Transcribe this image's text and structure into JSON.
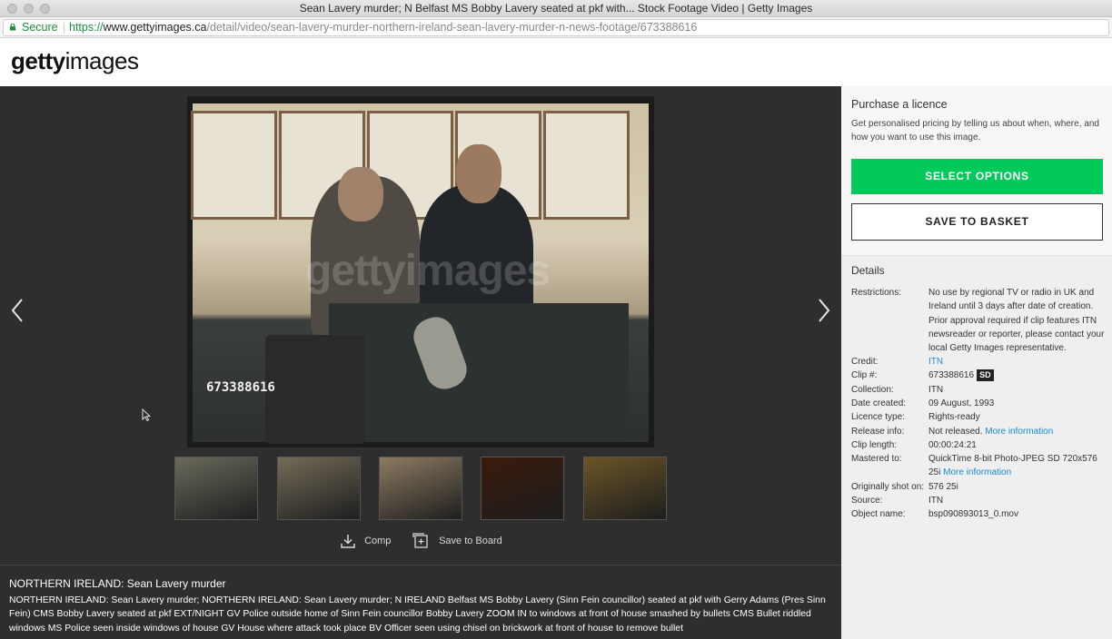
{
  "window": {
    "title": "Sean Lavery murder; N Belfast MS Bobby Lavery seated at pkf with... Stock Footage Video | Getty Images"
  },
  "address_bar": {
    "secure_label": "Secure",
    "url_scheme": "https://",
    "url_host": "www.gettyimages.ca",
    "url_path": "/detail/video/sean-lavery-murder-northern-ireland-sean-lavery-murder-n-news-footage/673388616"
  },
  "header": {
    "logo_bold": "getty",
    "logo_light": "images"
  },
  "player": {
    "watermark": "gettyimages",
    "clip_number_overlay": "673388616",
    "prev_icon": "chevron-left-icon",
    "next_icon": "chevron-right-icon"
  },
  "thumbnails": [
    {
      "label": "thumbnail-1",
      "color": "#6b6a5c"
    },
    {
      "label": "thumbnail-2",
      "color": "#746b58"
    },
    {
      "label": "thumbnail-3",
      "color": "#8c7b62"
    },
    {
      "label": "thumbnail-4",
      "color": "#3a1a0c"
    },
    {
      "label": "thumbnail-5",
      "color": "#6a5526"
    }
  ],
  "actions": {
    "comp_label": "Comp",
    "save_board_label": "Save to Board"
  },
  "caption": {
    "title": "NORTHERN IRELAND: Sean Lavery murder",
    "body": "NORTHERN IRELAND: Sean Lavery murder; NORTHERN IRELAND: Sean Lavery murder; N IRELAND Belfast MS Bobby Lavery (Sinn Fein councillor) seated at pkf with Gerry Adams (Pres Sinn Fein) CMS Bobby Lavery seated at pkf EXT/NIGHT GV Police outside home of Sinn Fein councillor Bobby Lavery ZOOM IN to windows at front of house smashed by bullets CMS Bullet riddled windows MS Police seen inside windows of house GV House where attack took place BV Officer seen using chisel on brickwork at front of house to remove bullet"
  },
  "purchase": {
    "title": "Purchase a licence",
    "description": "Get personalised pricing by telling us about when, where, and how you want to use this image.",
    "select_options": "SELECT OPTIONS",
    "save_to_basket": "SAVE TO BASKET"
  },
  "details": {
    "title": "Details",
    "restrictions_label": "Restrictions:",
    "restrictions_value": "No use by regional TV or radio in UK and Ireland until 3 days after date of creation. Prior approval required if clip features ITN newsreader or reporter, please contact your local Getty Images representative.",
    "credit_label": "Credit:",
    "credit_value": "ITN",
    "clip_label": "Clip #:",
    "clip_value": "673388616",
    "clip_badge": "SD",
    "collection_label": "Collection:",
    "collection_value": "ITN",
    "date_label": "Date created:",
    "date_value": "09 August, 1993",
    "licence_label": "Licence type:",
    "licence_value": "Rights-ready",
    "release_label": "Release info:",
    "release_value": "Not released.",
    "release_link": "More information",
    "length_label": "Clip length:",
    "length_value": "00:00:24:21",
    "mastered_label": "Mastered to:",
    "mastered_value": "QuickTime 8-bit Photo-JPEG SD 720x576 25i",
    "mastered_link": "More information",
    "shot_label": "Originally shot on:",
    "shot_value": "576 25i",
    "source_label": "Source:",
    "source_value": "ITN",
    "object_label": "Object name:",
    "object_value": "bsp090893013_0.mov"
  },
  "colors": {
    "accent_green": "#02c95a",
    "link_blue": "#1a8bd6",
    "dark_bg": "#2e2e2e"
  }
}
